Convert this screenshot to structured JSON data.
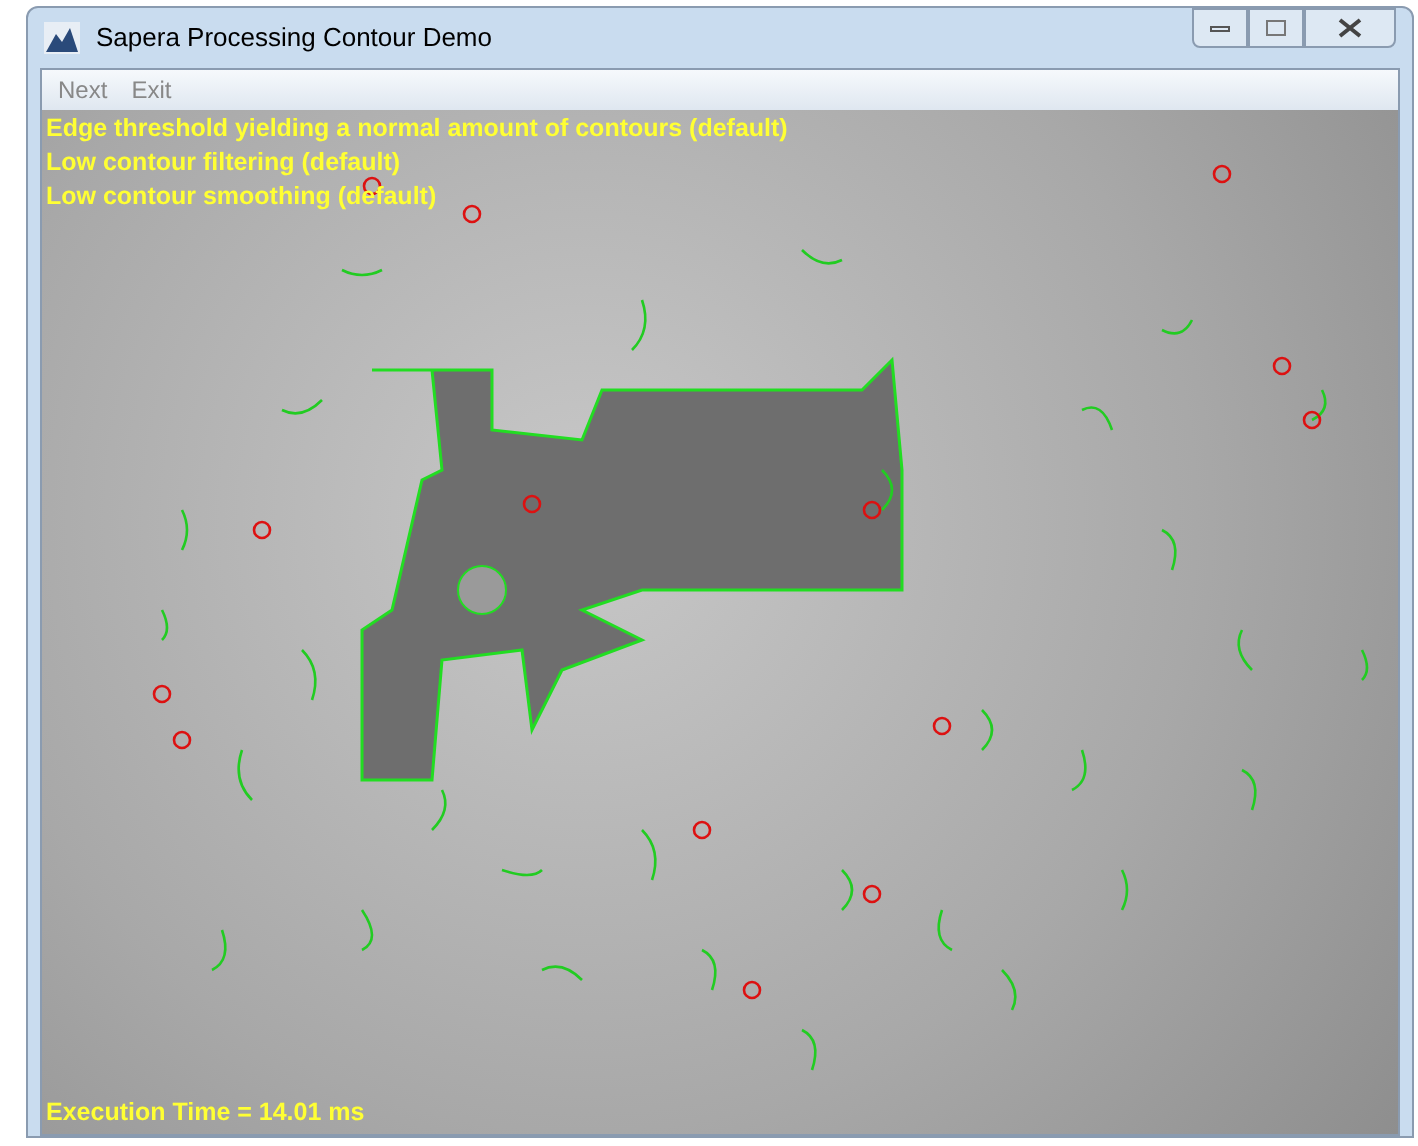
{
  "window": {
    "title": "Sapera Processing Contour Demo"
  },
  "menu": [
    {
      "label": "Next"
    },
    {
      "label": "Exit"
    }
  ],
  "overlay": {
    "lines": [
      "Edge threshold yielding a normal amount of contours (default)",
      "Low contour filtering (default)",
      "Low contour smoothing (default)"
    ],
    "execution_time": "Execution Time = 14.01 ms"
  }
}
